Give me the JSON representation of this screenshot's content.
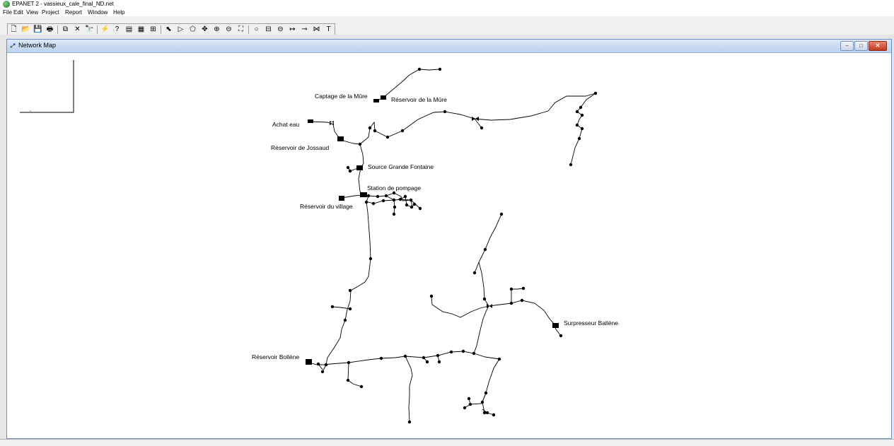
{
  "window": {
    "title": "EPANET 2 - vassieux_cale_final_ND.net"
  },
  "menu": {
    "items": [
      {
        "id": "file",
        "label": "File"
      },
      {
        "id": "edit",
        "label": "Edit"
      },
      {
        "id": "view",
        "label": "View"
      },
      {
        "id": "project",
        "label": "Project"
      },
      {
        "id": "report",
        "label": "Report"
      },
      {
        "id": "window",
        "label": "Window"
      },
      {
        "id": "help",
        "label": "Help"
      }
    ]
  },
  "toolbar": {
    "file_group": [
      {
        "name": "new-icon",
        "glyph": "🗋"
      },
      {
        "name": "open-icon",
        "glyph": "📂"
      },
      {
        "name": "save-icon",
        "glyph": "💾"
      },
      {
        "name": "print-icon",
        "glyph": "🖶"
      }
    ],
    "edit_group": [
      {
        "name": "copy-icon",
        "glyph": "⧉"
      },
      {
        "name": "delete-icon",
        "glyph": "✕"
      },
      {
        "name": "find-icon",
        "glyph": "🔭"
      }
    ],
    "analysis_group": [
      {
        "name": "run-icon",
        "glyph": "⚡"
      },
      {
        "name": "query-icon",
        "glyph": "?"
      },
      {
        "name": "graph-icon",
        "glyph": "▤"
      },
      {
        "name": "table-icon",
        "glyph": "▦"
      },
      {
        "name": "options-icon",
        "glyph": "⊞"
      }
    ],
    "map_group": [
      {
        "name": "select-object-icon",
        "glyph": "⬉"
      },
      {
        "name": "select-vertex-icon",
        "glyph": "▷"
      },
      {
        "name": "select-region-icon",
        "glyph": "⬠"
      },
      {
        "name": "pan-icon",
        "glyph": "✥"
      },
      {
        "name": "zoom-in-icon",
        "glyph": "⊕"
      },
      {
        "name": "zoom-out-icon",
        "glyph": "⊖"
      },
      {
        "name": "full-extent-icon",
        "glyph": "⛶"
      }
    ],
    "objects_group": [
      {
        "name": "add-junction-icon",
        "glyph": "○"
      },
      {
        "name": "add-reservoir-icon",
        "glyph": "⊟"
      },
      {
        "name": "add-tank-icon",
        "glyph": "⊖"
      },
      {
        "name": "add-pipe-icon",
        "glyph": "↦"
      },
      {
        "name": "add-pump-icon",
        "glyph": "⊸"
      },
      {
        "name": "add-valve-icon",
        "glyph": "⋈"
      },
      {
        "name": "add-label-icon",
        "glyph": "T"
      }
    ]
  },
  "map_window": {
    "title": "Network Map",
    "buttons": {
      "minimize": "–",
      "maximize": "□",
      "close": "✕"
    },
    "colors": {
      "pipe": "#000000",
      "node": "#000000",
      "background": "#ffffff"
    },
    "labels": {
      "captage_mure": "Captage de la Mûre",
      "reservoir_mure": "Réservoir de la Mûre",
      "achat_eau": "Achat eau",
      "reservoir_jossaud": "Réservoir de Jossaud",
      "source_grande_fontaine": "Source Grande Fontaine",
      "station_pompage": "Station de pompage",
      "reservoir_village": "Réservoir du village",
      "surpresseur_ballene": "Surpresseur Balléne",
      "reservoir_bollene": "Réservoir Bolléne"
    }
  }
}
